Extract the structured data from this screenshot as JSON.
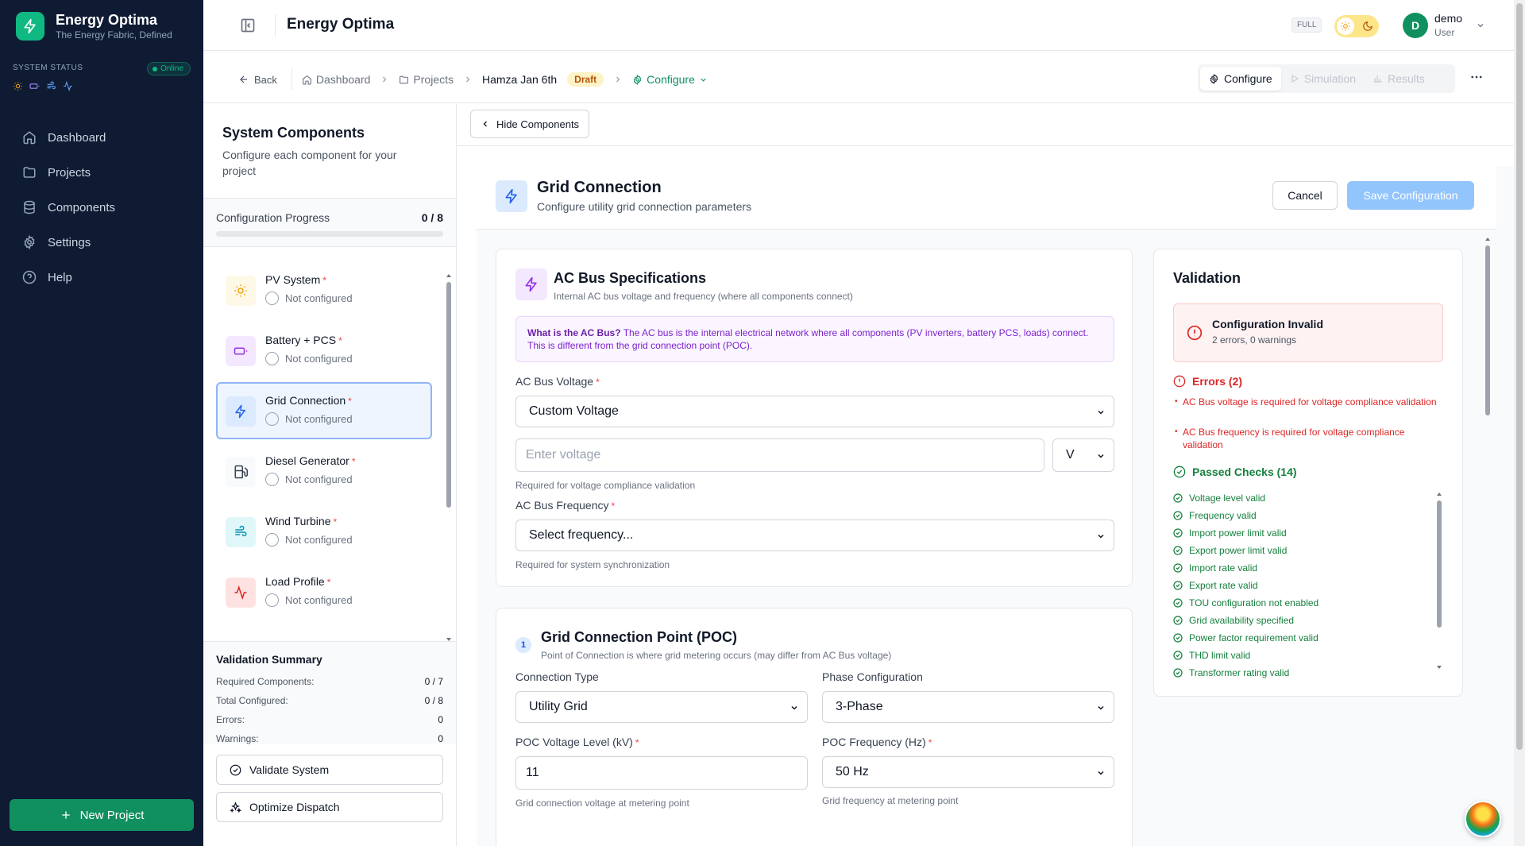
{
  "brand": {
    "name": "Energy Optima",
    "tagline": "The Energy Fabric, Defined"
  },
  "system_status": {
    "label": "SYSTEM STATUS",
    "badge": "Online",
    "icons": [
      "sun-icon",
      "battery-icon",
      "wind-icon",
      "activity-icon"
    ]
  },
  "nav": {
    "items": [
      {
        "label": "Dashboard",
        "icon": "home-icon"
      },
      {
        "label": "Projects",
        "icon": "folder-icon"
      },
      {
        "label": "Components",
        "icon": "database-icon"
      },
      {
        "label": "Settings",
        "icon": "gear-icon"
      },
      {
        "label": "Help",
        "icon": "help-circle-icon"
      }
    ],
    "new_project": "New Project"
  },
  "header": {
    "title": "Energy Optima",
    "mode_badge": "FULL",
    "user": {
      "initial": "D",
      "name": "demo",
      "role": "User"
    }
  },
  "breadcrumb": {
    "back": "Back",
    "dashboard": "Dashboard",
    "projects": "Projects",
    "project": "Hamza Jan 6th",
    "project_status": "Draft",
    "current": "Configure"
  },
  "mode_tabs": [
    {
      "label": "Configure",
      "active": true
    },
    {
      "label": "Simulation",
      "active": false
    },
    {
      "label": "Results",
      "active": false
    }
  ],
  "components_panel": {
    "title": "System Components",
    "subtitle": "Configure each component for your project",
    "progress_label": "Configuration Progress",
    "progress_value": "0 / 8",
    "progress_fraction": 0,
    "items": [
      {
        "name": "PV System",
        "status": "Not configured",
        "icon": "sun-icon",
        "color": "#f59e0b",
        "bg": "#fef9e7"
      },
      {
        "name": "Battery + PCS",
        "status": "Not configured",
        "icon": "battery-icon",
        "color": "#9333ea",
        "bg": "#f3e8ff"
      },
      {
        "name": "Grid Connection",
        "status": "Not configured",
        "icon": "zap-icon",
        "color": "#2563eb",
        "bg": "#dbeafe"
      },
      {
        "name": "Diesel Generator",
        "status": "Not configured",
        "icon": "fuel-icon",
        "color": "#374151",
        "bg": "#f3f4f6"
      },
      {
        "name": "Wind Turbine",
        "status": "Not configured",
        "icon": "wind-icon",
        "color": "#0891b2",
        "bg": "#e0f7fa"
      },
      {
        "name": "Load Profile",
        "status": "Not configured",
        "icon": "activity-icon",
        "color": "#dc2626",
        "bg": "#fee2e2"
      }
    ],
    "summary": {
      "title": "Validation Summary",
      "rows": [
        {
          "label": "Required Components:",
          "value": "0 / 7"
        },
        {
          "label": "Total Configured:",
          "value": "0 / 8"
        },
        {
          "label": "Errors:",
          "value": "0"
        },
        {
          "label": "Warnings:",
          "value": "0"
        }
      ]
    },
    "validate_button": "Validate System",
    "optimize_button": "Optimize Dispatch"
  },
  "main": {
    "hide_components": "Hide Components",
    "grid": {
      "title": "Grid Connection",
      "subtitle": "Configure utility grid connection parameters",
      "cancel": "Cancel",
      "save": "Save Configuration"
    },
    "ac_bus": {
      "title": "AC Bus Specifications",
      "subtitle": "Internal AC bus voltage and frequency (where all components connect)",
      "info_bold": "What is the AC Bus?",
      "info_text": "The AC bus is the internal electrical network where all components (PV inverters, battery PCS, loads) connect. This is different from the grid connection point (POC).",
      "voltage_label": "AC Bus Voltage",
      "voltage_select": "Custom Voltage",
      "voltage_placeholder": "Enter voltage",
      "voltage_unit": "V",
      "voltage_help": "Required for voltage compliance validation",
      "frequency_label": "AC Bus Frequency",
      "frequency_select": "Select frequency...",
      "frequency_help": "Required for system synchronization"
    },
    "poc": {
      "step": "1",
      "title": "Grid Connection Point (POC)",
      "subtitle": "Point of Connection is where grid metering occurs (may differ from AC Bus voltage)",
      "connection_type_label": "Connection Type",
      "connection_type": "Utility Grid",
      "phase_label": "Phase Configuration",
      "phase": "3-Phase",
      "voltage_label": "POC Voltage Level (kV)",
      "voltage": "11",
      "voltage_help": "Grid connection voltage at metering point",
      "frequency_label": "POC Frequency (Hz)",
      "frequency": "50 Hz",
      "frequency_help": "Grid frequency at metering point"
    },
    "validation": {
      "title": "Validation",
      "status_title": "Configuration Invalid",
      "status_sub": "2 errors, 0 warnings",
      "errors_title": "Errors (2)",
      "errors": [
        "AC Bus voltage is required for voltage compliance validation",
        "AC Bus frequency is required for voltage compliance validation"
      ],
      "passed_title": "Passed Checks (14)",
      "passed": [
        "Voltage level valid",
        "Frequency valid",
        "Import power limit valid",
        "Export power limit valid",
        "Import rate valid",
        "Export rate valid",
        "TOU configuration not enabled",
        "Grid availability specified",
        "Power factor requirement valid",
        "THD limit valid",
        "Transformer rating valid"
      ]
    }
  },
  "colors": {
    "sidebar_bg": "#0f1b33",
    "accent_green": "#10905f",
    "primary_blue": "#2563eb",
    "error_red": "#dc2626",
    "success_green": "#15803d"
  }
}
